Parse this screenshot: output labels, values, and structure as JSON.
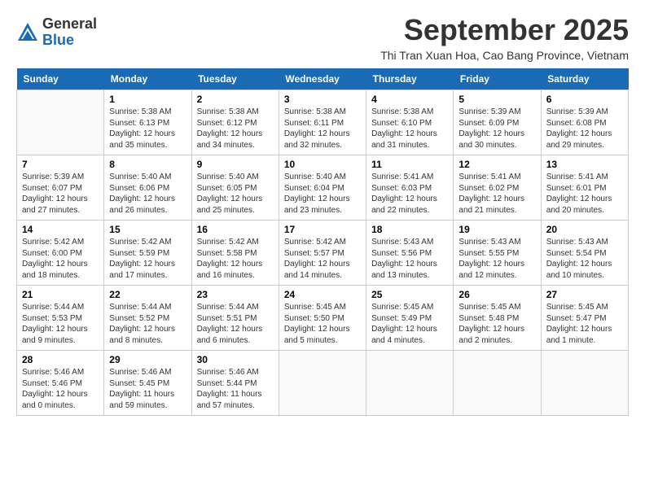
{
  "logo": {
    "general": "General",
    "blue": "Blue"
  },
  "title": "September 2025",
  "subtitle": "Thi Tran Xuan Hoa, Cao Bang Province, Vietnam",
  "weekdays": [
    "Sunday",
    "Monday",
    "Tuesday",
    "Wednesday",
    "Thursday",
    "Friday",
    "Saturday"
  ],
  "weeks": [
    [
      {
        "day": "",
        "info": ""
      },
      {
        "day": "1",
        "info": "Sunrise: 5:38 AM\nSunset: 6:13 PM\nDaylight: 12 hours\nand 35 minutes."
      },
      {
        "day": "2",
        "info": "Sunrise: 5:38 AM\nSunset: 6:12 PM\nDaylight: 12 hours\nand 34 minutes."
      },
      {
        "day": "3",
        "info": "Sunrise: 5:38 AM\nSunset: 6:11 PM\nDaylight: 12 hours\nand 32 minutes."
      },
      {
        "day": "4",
        "info": "Sunrise: 5:38 AM\nSunset: 6:10 PM\nDaylight: 12 hours\nand 31 minutes."
      },
      {
        "day": "5",
        "info": "Sunrise: 5:39 AM\nSunset: 6:09 PM\nDaylight: 12 hours\nand 30 minutes."
      },
      {
        "day": "6",
        "info": "Sunrise: 5:39 AM\nSunset: 6:08 PM\nDaylight: 12 hours\nand 29 minutes."
      }
    ],
    [
      {
        "day": "7",
        "info": "Sunrise: 5:39 AM\nSunset: 6:07 PM\nDaylight: 12 hours\nand 27 minutes."
      },
      {
        "day": "8",
        "info": "Sunrise: 5:40 AM\nSunset: 6:06 PM\nDaylight: 12 hours\nand 26 minutes."
      },
      {
        "day": "9",
        "info": "Sunrise: 5:40 AM\nSunset: 6:05 PM\nDaylight: 12 hours\nand 25 minutes."
      },
      {
        "day": "10",
        "info": "Sunrise: 5:40 AM\nSunset: 6:04 PM\nDaylight: 12 hours\nand 23 minutes."
      },
      {
        "day": "11",
        "info": "Sunrise: 5:41 AM\nSunset: 6:03 PM\nDaylight: 12 hours\nand 22 minutes."
      },
      {
        "day": "12",
        "info": "Sunrise: 5:41 AM\nSunset: 6:02 PM\nDaylight: 12 hours\nand 21 minutes."
      },
      {
        "day": "13",
        "info": "Sunrise: 5:41 AM\nSunset: 6:01 PM\nDaylight: 12 hours\nand 20 minutes."
      }
    ],
    [
      {
        "day": "14",
        "info": "Sunrise: 5:42 AM\nSunset: 6:00 PM\nDaylight: 12 hours\nand 18 minutes."
      },
      {
        "day": "15",
        "info": "Sunrise: 5:42 AM\nSunset: 5:59 PM\nDaylight: 12 hours\nand 17 minutes."
      },
      {
        "day": "16",
        "info": "Sunrise: 5:42 AM\nSunset: 5:58 PM\nDaylight: 12 hours\nand 16 minutes."
      },
      {
        "day": "17",
        "info": "Sunrise: 5:42 AM\nSunset: 5:57 PM\nDaylight: 12 hours\nand 14 minutes."
      },
      {
        "day": "18",
        "info": "Sunrise: 5:43 AM\nSunset: 5:56 PM\nDaylight: 12 hours\nand 13 minutes."
      },
      {
        "day": "19",
        "info": "Sunrise: 5:43 AM\nSunset: 5:55 PM\nDaylight: 12 hours\nand 12 minutes."
      },
      {
        "day": "20",
        "info": "Sunrise: 5:43 AM\nSunset: 5:54 PM\nDaylight: 12 hours\nand 10 minutes."
      }
    ],
    [
      {
        "day": "21",
        "info": "Sunrise: 5:44 AM\nSunset: 5:53 PM\nDaylight: 12 hours\nand 9 minutes."
      },
      {
        "day": "22",
        "info": "Sunrise: 5:44 AM\nSunset: 5:52 PM\nDaylight: 12 hours\nand 8 minutes."
      },
      {
        "day": "23",
        "info": "Sunrise: 5:44 AM\nSunset: 5:51 PM\nDaylight: 12 hours\nand 6 minutes."
      },
      {
        "day": "24",
        "info": "Sunrise: 5:45 AM\nSunset: 5:50 PM\nDaylight: 12 hours\nand 5 minutes."
      },
      {
        "day": "25",
        "info": "Sunrise: 5:45 AM\nSunset: 5:49 PM\nDaylight: 12 hours\nand 4 minutes."
      },
      {
        "day": "26",
        "info": "Sunrise: 5:45 AM\nSunset: 5:48 PM\nDaylight: 12 hours\nand 2 minutes."
      },
      {
        "day": "27",
        "info": "Sunrise: 5:45 AM\nSunset: 5:47 PM\nDaylight: 12 hours\nand 1 minute."
      }
    ],
    [
      {
        "day": "28",
        "info": "Sunrise: 5:46 AM\nSunset: 5:46 PM\nDaylight: 12 hours\nand 0 minutes."
      },
      {
        "day": "29",
        "info": "Sunrise: 5:46 AM\nSunset: 5:45 PM\nDaylight: 11 hours\nand 59 minutes."
      },
      {
        "day": "30",
        "info": "Sunrise: 5:46 AM\nSunset: 5:44 PM\nDaylight: 11 hours\nand 57 minutes."
      },
      {
        "day": "",
        "info": ""
      },
      {
        "day": "",
        "info": ""
      },
      {
        "day": "",
        "info": ""
      },
      {
        "day": "",
        "info": ""
      }
    ]
  ]
}
